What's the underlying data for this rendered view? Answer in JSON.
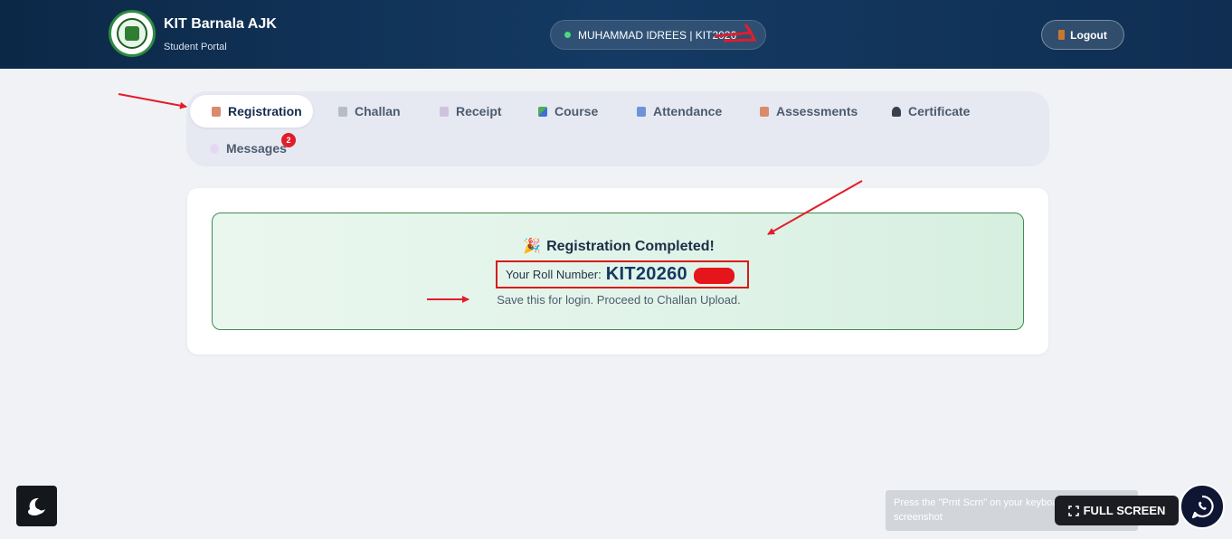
{
  "header": {
    "brand_title": "KIT Barnala AJK",
    "brand_subtitle": "Student Portal",
    "user_label": "MUHAMMAD IDREES | KIT2026",
    "logout_label": "Logout"
  },
  "tabs": [
    {
      "label": "Registration",
      "icon": "registration-icon",
      "active": true
    },
    {
      "label": "Challan",
      "icon": "challan-icon"
    },
    {
      "label": "Receipt",
      "icon": "receipt-icon"
    },
    {
      "label": "Course",
      "icon": "course-icon"
    },
    {
      "label": "Attendance",
      "icon": "calendar-icon"
    },
    {
      "label": "Assessments",
      "icon": "assessments-icon"
    },
    {
      "label": "Certificate",
      "icon": "graduation-cap-icon"
    },
    {
      "label": "Messages",
      "icon": "speech-bubble-icon",
      "badge": "2"
    }
  ],
  "main": {
    "title": "Registration Completed!",
    "roll_label": "Your Roll Number:",
    "roll_value": "KIT20260",
    "hint": "Save this for login. Proceed to Challan Upload."
  },
  "toast": {
    "text": "Press the \"Prnt Scrn\" on your keyboard to take a screenshot"
  },
  "fullscreen_label": "FULL SCREEN",
  "colors": {
    "header": "#143a63",
    "success_border": "#3f8b52",
    "annotation_red": "#e21d2a",
    "badge": "#e21d2a"
  }
}
